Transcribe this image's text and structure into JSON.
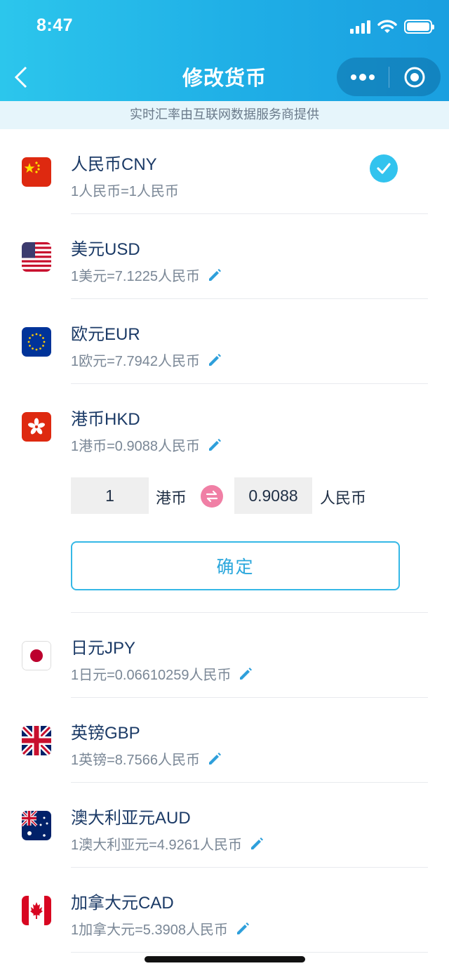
{
  "status_bar": {
    "time": "8:47"
  },
  "nav": {
    "title": "修改货币"
  },
  "notice": "实时汇率由互联网数据服务商提供",
  "currencies_top": [
    {
      "name": "人民币CNY",
      "rate": "1人民币=1人民币",
      "selected": true,
      "flag": "china-flag-icon"
    },
    {
      "name": "美元USD",
      "rate": "1美元=7.1225人民币",
      "flag": "usa-flag-icon"
    },
    {
      "name": "欧元EUR",
      "rate": "1欧元=7.7942人民币",
      "flag": "eu-flag-icon"
    },
    {
      "name": "港币HKD",
      "rate": "1港币=0.9088人民币",
      "flag": "hongkong-flag-icon"
    }
  ],
  "converter": {
    "from_value": "1",
    "from_unit": "港币",
    "to_value": "0.9088",
    "to_unit": "人民币",
    "confirm_label": "确定"
  },
  "currencies_bottom": [
    {
      "name": "日元JPY",
      "rate": "1日元=0.06610259人民币",
      "flag": "japan-flag-icon"
    },
    {
      "name": "英镑GBP",
      "rate": "1英镑=8.7566人民币",
      "flag": "uk-flag-icon"
    },
    {
      "name": "澳大利亚元AUD",
      "rate": "1澳大利亚元=4.9261人民币",
      "flag": "australia-flag-icon"
    },
    {
      "name": "加拿大元CAD",
      "rate": "1加拿大元=5.3908人民币",
      "flag": "canada-flag-icon"
    }
  ],
  "colors": {
    "header_gradient_start": "#2cc6ec",
    "header_gradient_end": "#1a9fe0",
    "accent": "#32c3ee",
    "swap_icon": "#f07fa5",
    "edit_icon": "#2e9fdb"
  }
}
